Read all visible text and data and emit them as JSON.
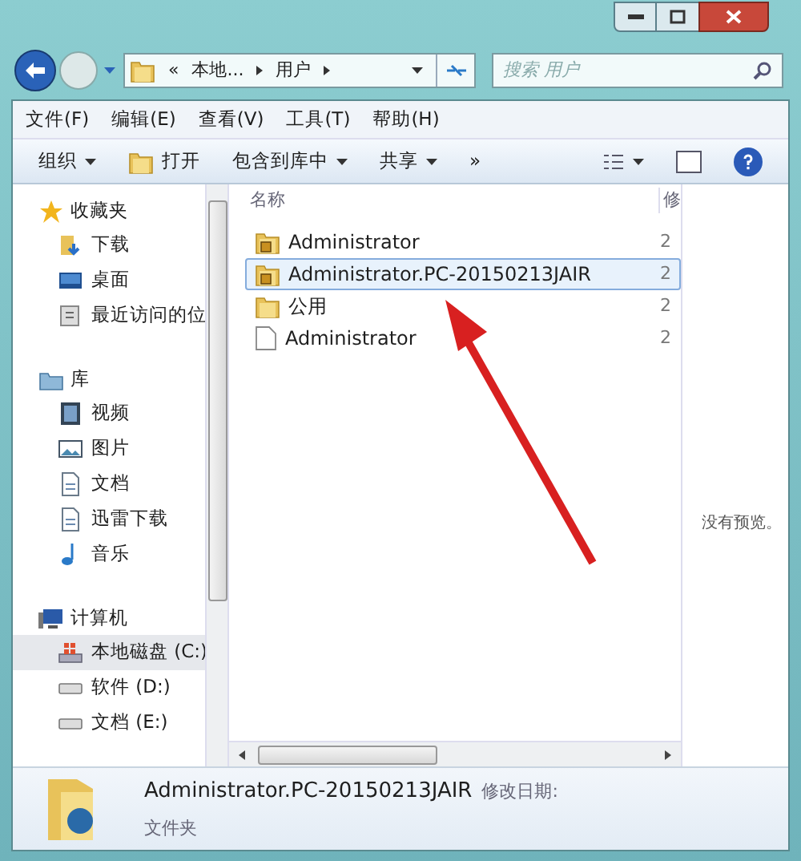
{
  "address": {
    "crumbs": [
      "«",
      "本地...",
      "用户"
    ]
  },
  "search": {
    "placeholder": "搜索 用户"
  },
  "menu": [
    "文件(F)",
    "编辑(E)",
    "查看(V)",
    "工具(T)",
    "帮助(H)"
  ],
  "toolbar": [
    {
      "label": "组织",
      "kind": "dropdown"
    },
    {
      "label": "打开",
      "kind": "open"
    },
    {
      "label": "包含到库中",
      "kind": "dropdown"
    },
    {
      "label": "共享",
      "kind": "dropdown"
    },
    {
      "label": "»",
      "kind": "more"
    }
  ],
  "nav": [
    {
      "label": "收藏夹",
      "kind": "star",
      "children": [
        {
          "label": "下载",
          "kind": "download",
          "selected": false
        },
        {
          "label": "桌面",
          "kind": "desktop",
          "selected": false
        },
        {
          "label": "最近访问的位",
          "kind": "recent",
          "selected": false
        }
      ]
    },
    {
      "label": "库",
      "kind": "library",
      "children": [
        {
          "label": "视频",
          "kind": "video",
          "selected": false
        },
        {
          "label": "图片",
          "kind": "picture",
          "selected": false
        },
        {
          "label": "文档",
          "kind": "doc",
          "selected": false
        },
        {
          "label": "迅雷下载",
          "kind": "doc",
          "selected": false
        },
        {
          "label": "音乐",
          "kind": "music",
          "selected": false
        }
      ]
    },
    {
      "label": "计算机",
      "kind": "computer",
      "children": [
        {
          "label": "本地磁盘 (C:)",
          "kind": "system-drive",
          "selected": true
        },
        {
          "label": "软件 (D:)",
          "kind": "drive",
          "selected": false
        },
        {
          "label": "文档 (E:)",
          "kind": "drive",
          "selected": false
        }
      ]
    }
  ],
  "files": {
    "columns": [
      "名称",
      "修"
    ],
    "rows": [
      {
        "name": "Administrator",
        "kind": "user-folder",
        "date": "2",
        "selected": false
      },
      {
        "name": "Administrator.PC-20150213JAIR",
        "kind": "user-folder",
        "date": "2",
        "selected": true
      },
      {
        "name": "公用",
        "kind": "folder",
        "date": "2",
        "selected": false
      },
      {
        "name": "Administrator",
        "kind": "file",
        "date": "2",
        "selected": false
      }
    ]
  },
  "preview": {
    "text": "没有预览。"
  },
  "details": {
    "name": "Administrator.PC-20150213JAIR",
    "date_label": "修改日期:",
    "type": "文件夹"
  }
}
